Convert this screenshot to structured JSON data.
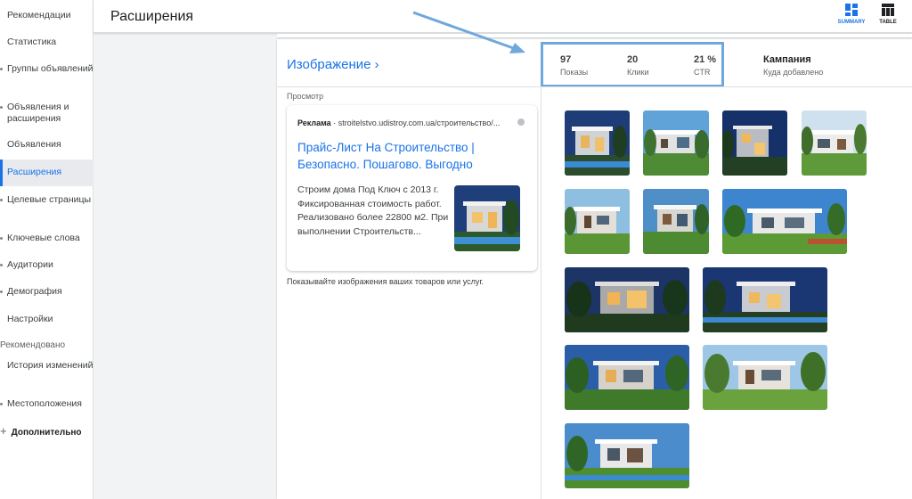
{
  "sidebar": {
    "items": [
      {
        "label": "Рекомендации"
      },
      {
        "label": "Статистика"
      },
      {
        "label": "Группы объявлений"
      },
      {
        "label": "Объявления и расширения"
      },
      {
        "label": "Объявления"
      },
      {
        "label": "Расширения"
      },
      {
        "label": "Целевые страницы"
      },
      {
        "label": "Ключевые слова"
      },
      {
        "label": "Аудитории"
      },
      {
        "label": "Демография"
      },
      {
        "label": "Настройки"
      }
    ],
    "section_label": "Рекомендовано",
    "items2": [
      {
        "label": "История изменений"
      },
      {
        "label": "Местоположения"
      }
    ],
    "more_label": "Дополнительно",
    "active_item": "Расширения"
  },
  "header": {
    "title": "Расширения",
    "summary_label": "SUMMARY",
    "table_label": "TABLE"
  },
  "card": {
    "title": "Изображение",
    "stats": [
      {
        "value": "97",
        "label": "Показы"
      },
      {
        "value": "20",
        "label": "Клики"
      },
      {
        "value": "21 %",
        "label": "CTR"
      }
    ],
    "campaign": {
      "value": "Кампания",
      "label": "Куда добавлено"
    },
    "preview_label": "Просмотр",
    "ad": {
      "badge": "Реклама",
      "url": "stroitelstvo.udistroy.com.ua/строительство/...",
      "headline": "Прайс-Лист На Строительство | Безопасно. Пошагово. Выгодно",
      "description": "Строим дома Под Ключ с 2013 г. Фиксированная стоимость работ. Реализовано более 22800 м2. При выполнении Строительств..."
    },
    "helper_text": "Показывайте изображения ваших товаров или услуг."
  },
  "colors": {
    "accent": "#1a73e8",
    "highlight": "#6fa8dc"
  }
}
